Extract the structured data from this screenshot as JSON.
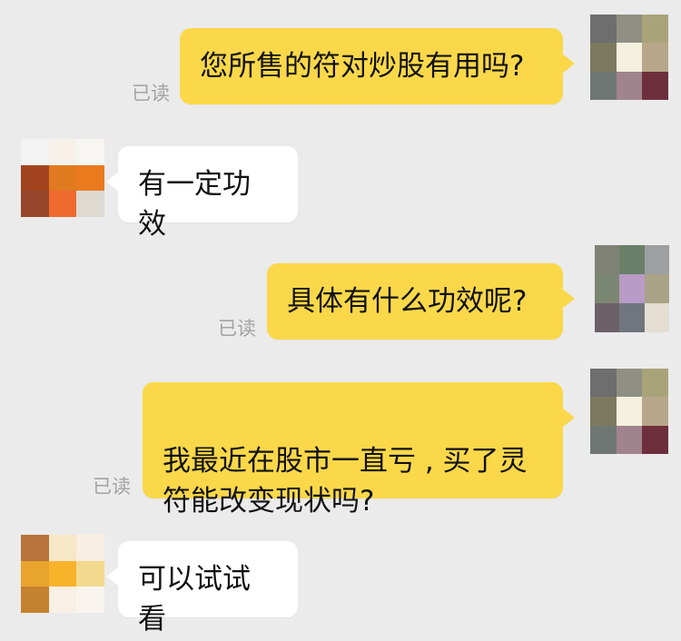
{
  "messages": [
    {
      "direction": "sent",
      "text": "您所售的符对炒股有用吗?",
      "status": "已读"
    },
    {
      "direction": "received",
      "text": "有一定功效"
    },
    {
      "direction": "sent",
      "text": "具体有什么功效呢?",
      "status": "已读"
    },
    {
      "direction": "sent",
      "text": "我最近在股市一直亏 , 买了灵\n符能改变现状吗?",
      "status": "已读"
    },
    {
      "direction": "received",
      "text": "可以试试看"
    }
  ],
  "colors": {
    "background": "#ebebeb",
    "sent_bubble": "#fbd84a",
    "received_bubble": "#ffffff",
    "read_receipt": "#a3a3a3"
  },
  "avatars": {
    "self_icon": "pixelated-avatar",
    "contact_icon": "pixelated-avatar"
  }
}
